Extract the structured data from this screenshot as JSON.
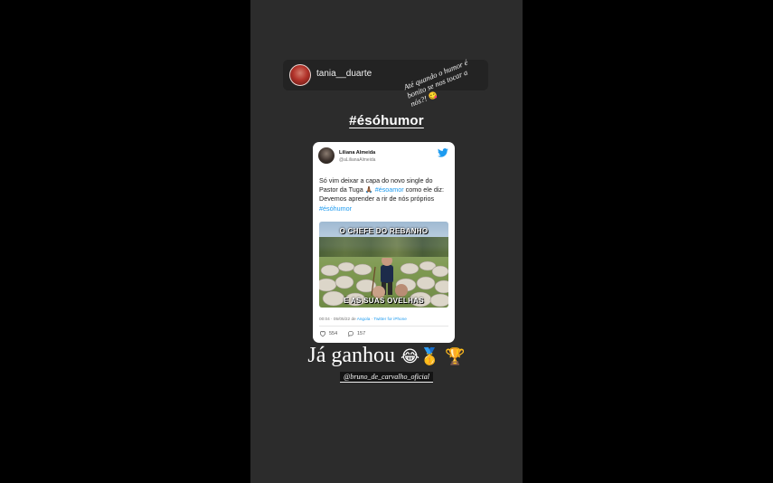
{
  "story": {
    "username": "tania__duarte",
    "note_text": "Até quando o humor é bonito se nos tocar a nós?!",
    "note_emoji": "😋",
    "hashtag": "#ésóhumor",
    "caption_text": "Já ganhou",
    "caption_emojis": "😂🥇 🏆",
    "mention": "@bruno_de_carvalho_oficial"
  },
  "tweet": {
    "name": "Liliana Almeida",
    "handle": "@aLilianaAlmeida",
    "text_1": "Só vim deixar a capa do novo single do Pastor da Tuga 🙏🏾 ",
    "tag_1": "#ésoamor",
    "text_2": " como ele diz: Devemos aprender a rir de nós próprios ",
    "tag_2": "#ésóhumor",
    "meme_top": "O CHEFE DO REBANHO",
    "meme_bottom": "E AS SUAS OVELHAS",
    "meta_time": "00:04 · 05/05/22 de ",
    "meta_location": "Angola",
    "meta_sep": " · ",
    "meta_source": "Twitter for iPhone",
    "likes": "554",
    "replies": "157"
  },
  "colors": {
    "background": "#000000",
    "story_bg": "#2c2c2c",
    "tweet_link": "#1d9bf0"
  },
  "icons": [
    "twitter-bird-icon",
    "heart-icon",
    "reply-icon"
  ]
}
